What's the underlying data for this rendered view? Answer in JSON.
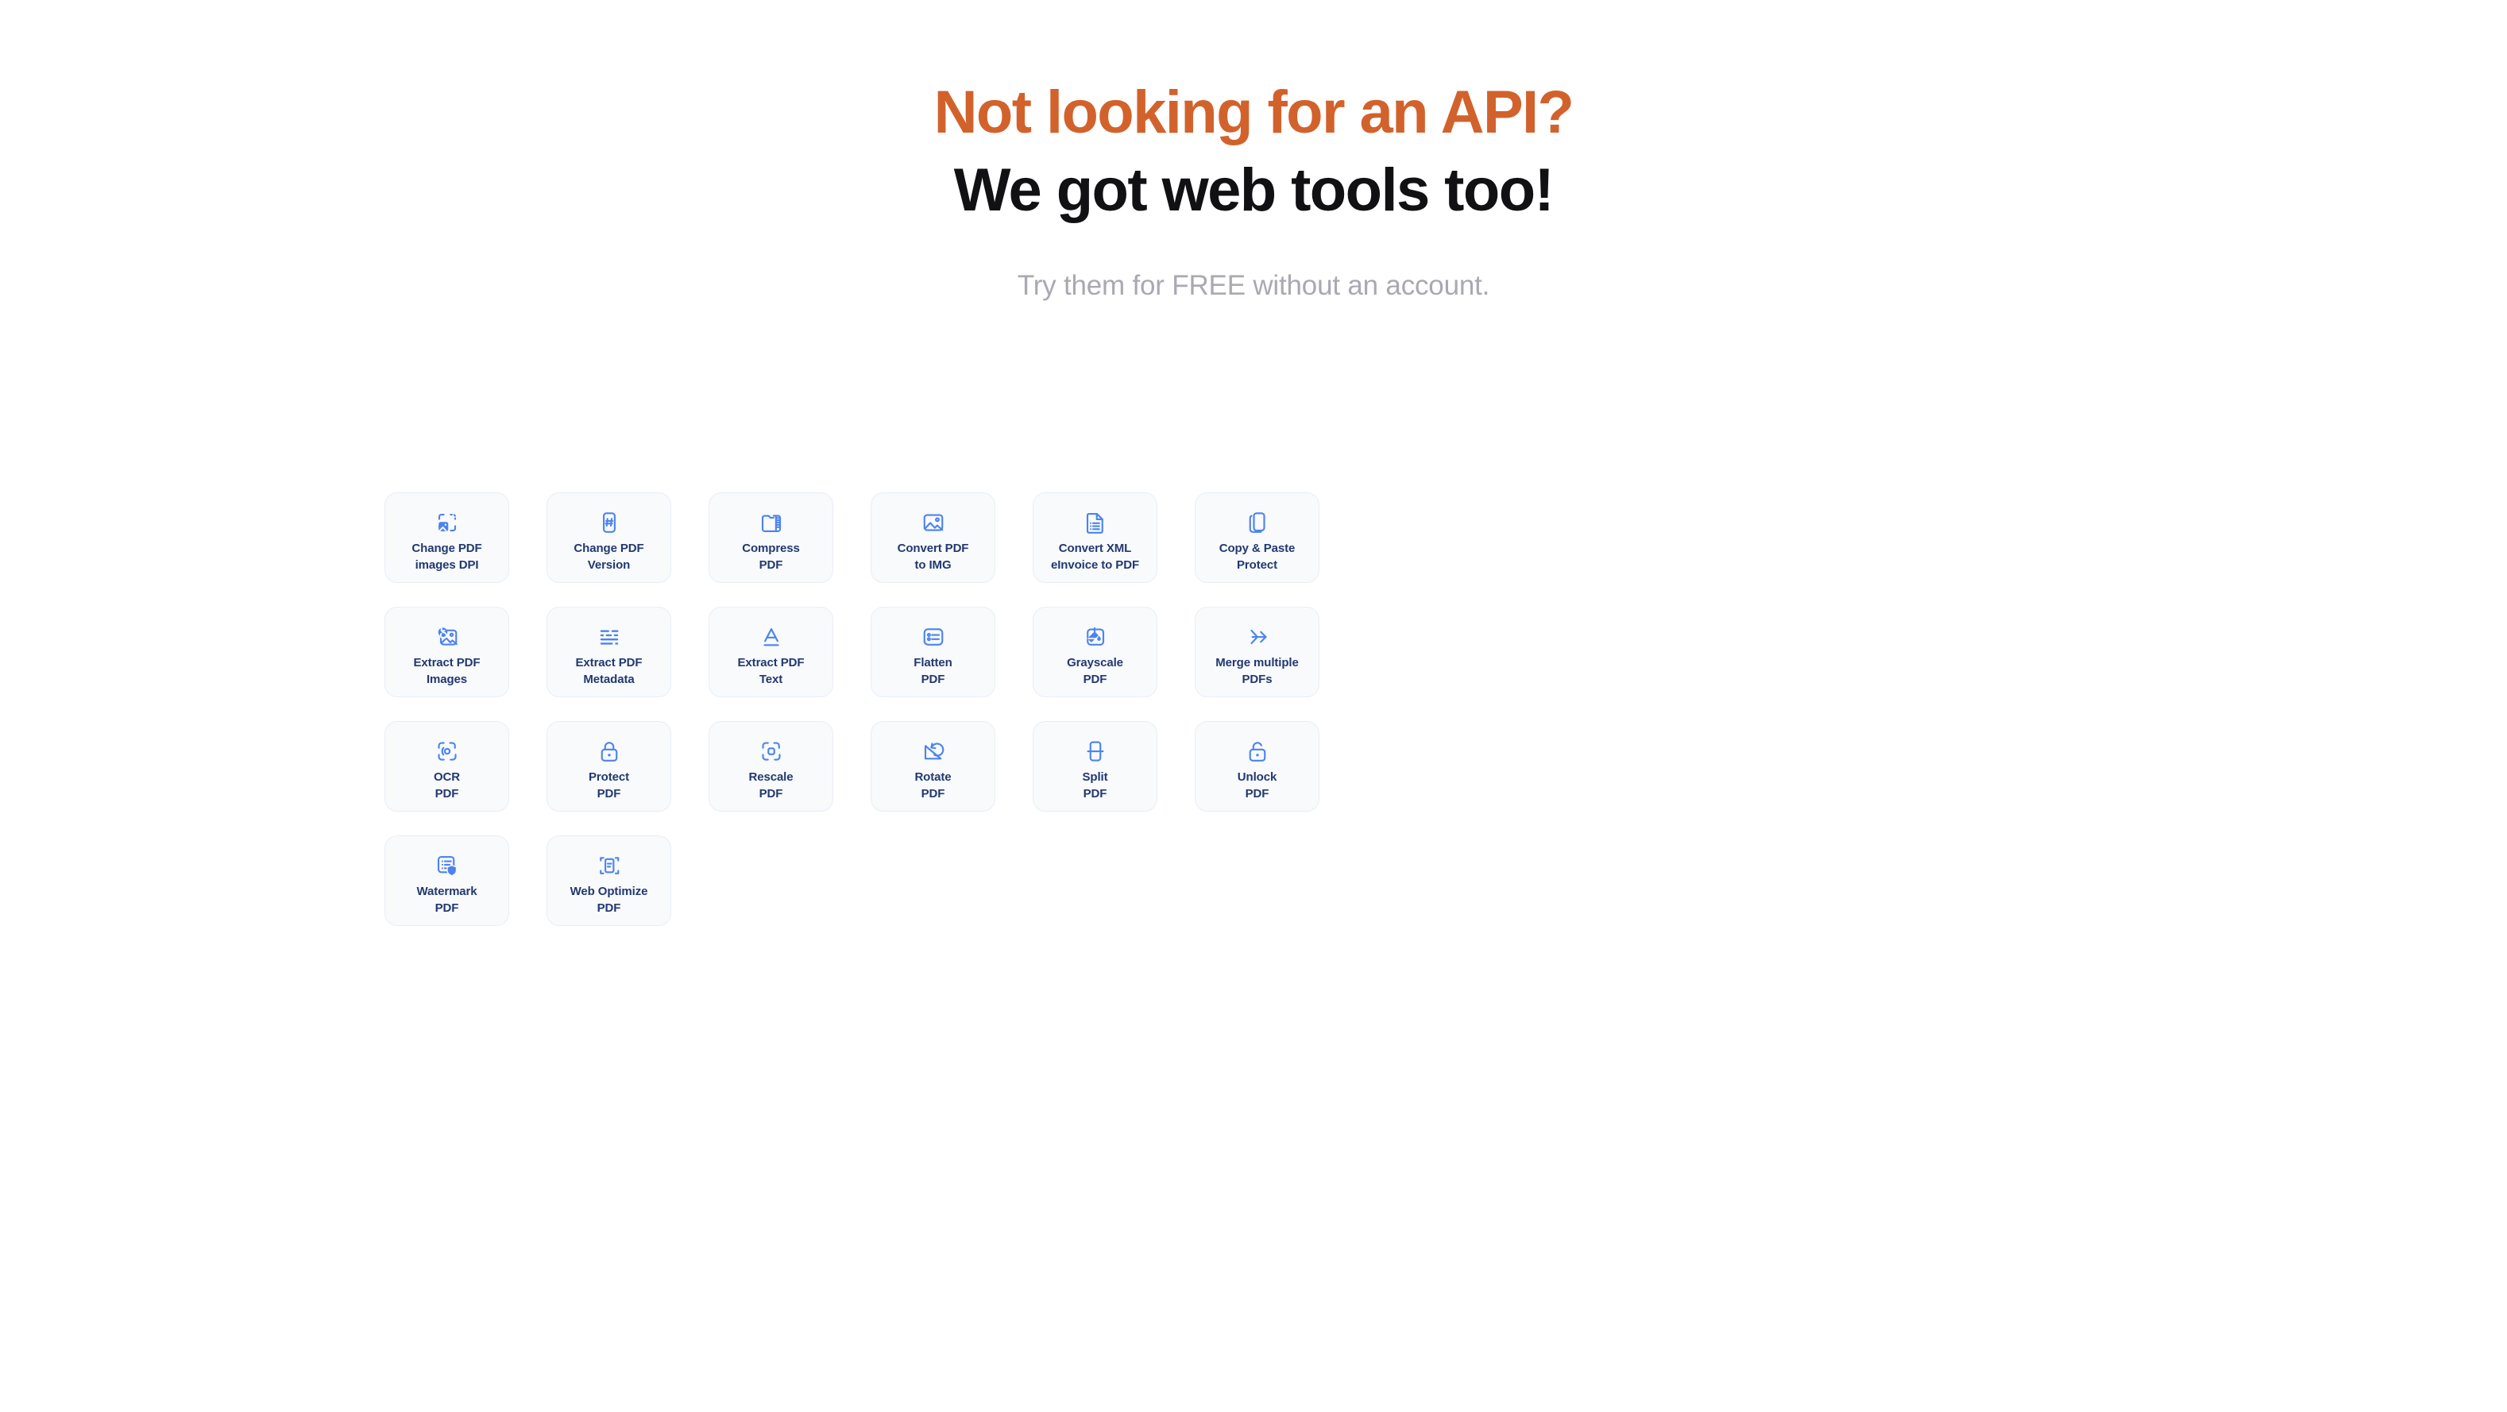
{
  "header": {
    "headline_top": "Not looking for an API?",
    "headline_bottom": "We got web tools too!",
    "subhead": "Try them for FREE without an account.",
    "accent_color": "#d2622c",
    "headline_color": "#111114",
    "subhead_color": "#a9a9b2"
  },
  "theme": {
    "card_background": "#f8fafc",
    "card_border": "#e8eef7",
    "icon_color": "#4b83f0",
    "label_color": "#223870",
    "page_background": "#ffffff"
  },
  "tools": [
    {
      "label": "Change PDF\nimages DPI",
      "icon": "image-crop-icon",
      "name": "change-pdf-images-dpi"
    },
    {
      "label": "Change PDF\nVersion",
      "icon": "hash-page-icon",
      "name": "change-pdf-version"
    },
    {
      "label": "Compress\nPDF",
      "icon": "zip-archive-icon",
      "name": "compress-pdf"
    },
    {
      "label": "Convert PDF\nto IMG",
      "icon": "picture-icon",
      "name": "convert-pdf-to-img"
    },
    {
      "label": "Convert XML\neInvoice to PDF",
      "icon": "document-list-icon",
      "name": "convert-xml-einvoice-to-pdf"
    },
    {
      "label": "Copy & Paste\nProtect",
      "icon": "copy-pages-icon",
      "name": "copy-paste-protect"
    },
    {
      "label": "Extract PDF\nImages",
      "icon": "image-extract-icon",
      "name": "extract-pdf-images"
    },
    {
      "label": "Extract PDF\nMetadata",
      "icon": "metadata-lines-icon",
      "name": "extract-pdf-metadata"
    },
    {
      "label": "Extract PDF\nText",
      "icon": "letter-a-underline-icon",
      "name": "extract-pdf-text"
    },
    {
      "label": "Flatten\nPDF",
      "icon": "form-box-icon",
      "name": "flatten-pdf"
    },
    {
      "label": "Grayscale\nPDF",
      "icon": "paint-bucket-icon",
      "name": "grayscale-pdf"
    },
    {
      "label": "Merge multiple\nPDFs",
      "icon": "merge-arrows-icon",
      "name": "merge-multiple-pdfs"
    },
    {
      "label": "OCR\nPDF",
      "icon": "scan-lens-icon",
      "name": "ocr-pdf"
    },
    {
      "label": "Protect\nPDF",
      "icon": "lock-closed-icon",
      "name": "protect-pdf"
    },
    {
      "label": "Rescale\nPDF",
      "icon": "resize-frame-icon",
      "name": "rescale-pdf"
    },
    {
      "label": "Rotate\nPDF",
      "icon": "rotate-icon",
      "name": "rotate-pdf"
    },
    {
      "label": "Split\nPDF",
      "icon": "split-page-icon",
      "name": "split-pdf"
    },
    {
      "label": "Unlock\nPDF",
      "icon": "lock-open-icon",
      "name": "unlock-pdf"
    },
    {
      "label": "Watermark\nPDF",
      "icon": "document-shield-icon",
      "name": "watermark-pdf"
    },
    {
      "label": "Web Optimize\nPDF",
      "icon": "document-crop-marks-icon",
      "name": "web-optimize-pdf"
    }
  ]
}
